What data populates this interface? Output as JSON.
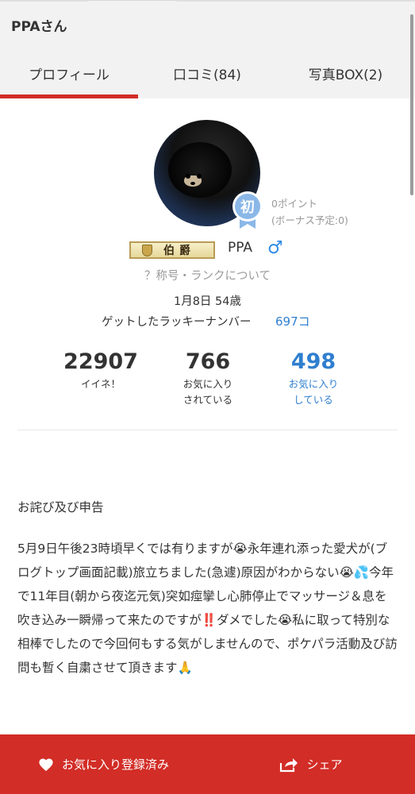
{
  "header": {
    "title": "PPAさん"
  },
  "tabs": [
    {
      "label": "プロフィール",
      "active": true
    },
    {
      "label": "口コミ(84)"
    },
    {
      "label": "写真BOX(2)"
    }
  ],
  "profile": {
    "badge": "初",
    "points": "0ポイント",
    "bonus": "(ボーナス予定:0)",
    "rank_title": "伯爵",
    "username": "PPA",
    "gender_symbol": "♂",
    "rank_link": "？称号・ランクについて",
    "birthday_age": "1月8日 54歳",
    "lucky_label": "ゲットしたラッキーナンバー",
    "lucky_value": "697コ"
  },
  "stats": [
    {
      "value": "22907",
      "label_line1": "イイネ！",
      "label_line2": ""
    },
    {
      "value": "766",
      "label_line1": "お気に入り",
      "label_line2": "されている"
    },
    {
      "value": "498",
      "label_line1": "お気に入り",
      "label_line2": "している"
    }
  ],
  "bio": {
    "title": "お詫び及び申告",
    "body": "5月9日午後23時頃早くでは有りますが😭永年連れ添った愛犬が(ブログトップ画面記載)旅立ちました(急遽)原因がわからない😭💦今年で11年目(朝から夜迄元気)突如痙攣し心肺停止でマッサージ＆息を吹き込み一瞬帰って来たのですが‼️ダメでした😭私に取って特別な相棒でしたので今回何もする気がしませんので、ポケパラ活動及び訪問も暫く自粛させて頂きます🙏"
  },
  "footer": {
    "favorite_label": "お気に入り登録済み",
    "share_label": "シェア"
  },
  "colors": {
    "accent_red": "#d22d26",
    "link_blue": "#2f7fcf",
    "badge_blue": "#8bb8e8"
  }
}
